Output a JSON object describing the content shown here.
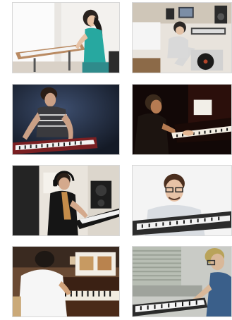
{
  "gallery": {
    "photos": [
      {
        "subject": "woman-at-keyboard-stand"
      },
      {
        "subject": "home-studio-with-turntable"
      },
      {
        "subject": "man-playing-synthesizer"
      },
      {
        "subject": "man-at-grand-piano-dark"
      },
      {
        "subject": "man-with-headphones-at-keyboard"
      },
      {
        "subject": "man-with-glasses-at-keyboard"
      },
      {
        "subject": "man-at-upright-piano"
      },
      {
        "subject": "man-playing-piano-side-view"
      }
    ]
  }
}
